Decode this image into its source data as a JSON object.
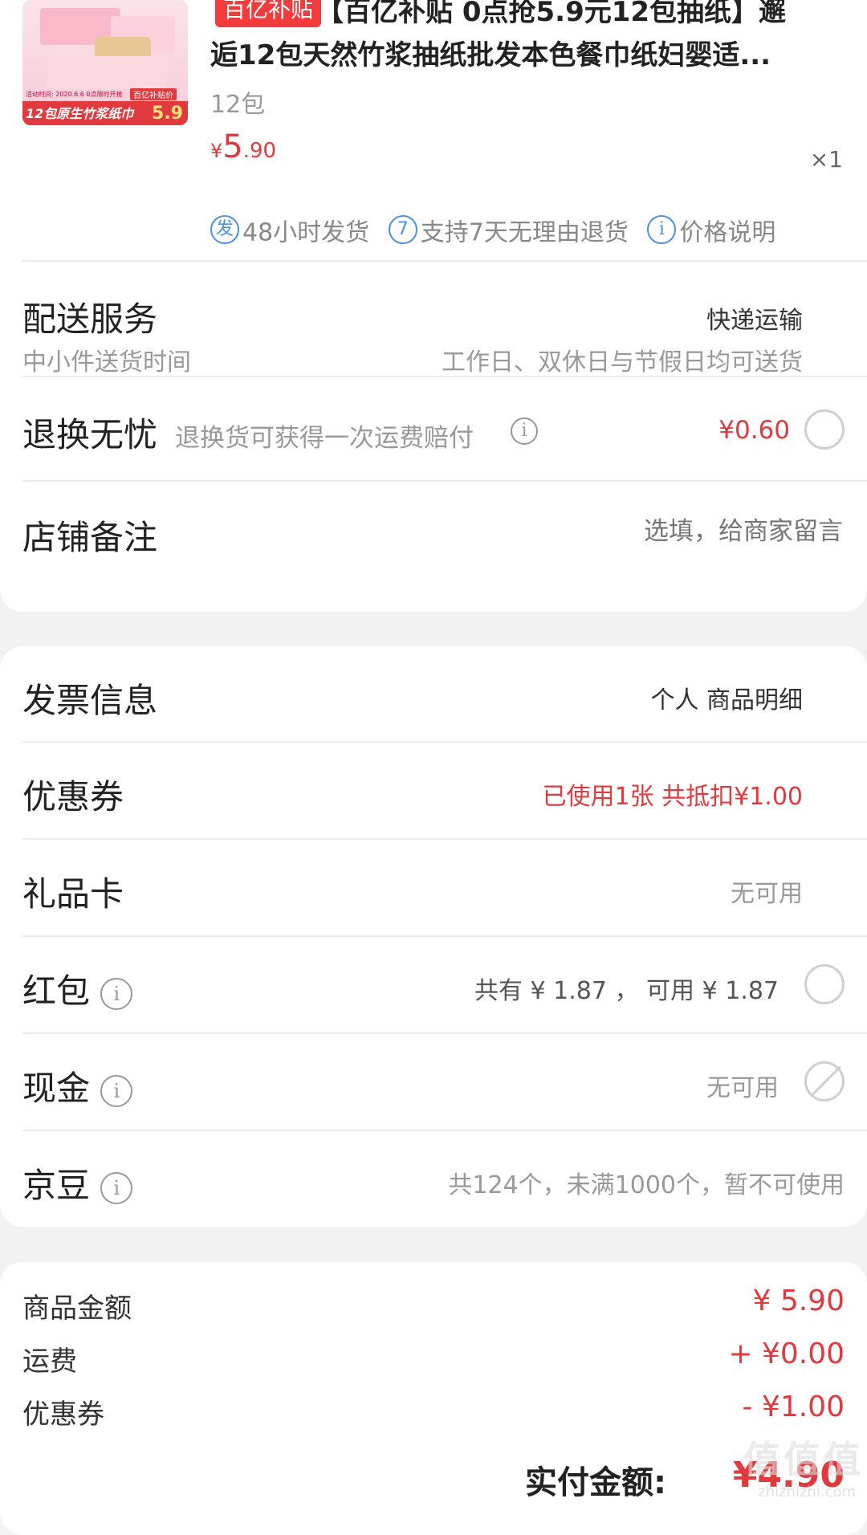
{
  "product": {
    "image_badge_text": "12包原生竹浆纸巾",
    "image_badge_price": "5.9",
    "image_small_text": "活动时间: 2020.6.6 0点限时开抢",
    "image_tag_text": "百亿补贴价",
    "badge": "百亿补贴",
    "title_line1": "【百亿补贴 0点抢5.9元12包抽纸】邂",
    "title_line2": "逅12包天然竹浆抽纸批发本色餐巾纸妇婴适...",
    "spec": "12包",
    "price_symbol": "¥",
    "price_int": "5",
    "price_dec": ".90",
    "quantity": "×1",
    "service_tags": [
      {
        "icon": "发",
        "label": "48小时发货"
      },
      {
        "icon": "7",
        "label": "支持7天无理由退货"
      },
      {
        "icon": "i",
        "label": "价格说明"
      }
    ]
  },
  "delivery": {
    "title": "配送服务",
    "value": "快递运输",
    "sub_label": "中小件送货时间",
    "sub_value": "工作日、双休日与节假日均可送货"
  },
  "return_insurance": {
    "title": "退换无忧",
    "desc": "退换货可获得一次运费赔付",
    "price": "¥0.60"
  },
  "shop_note": {
    "title": "店铺备注",
    "placeholder": "选填，给商家留言"
  },
  "invoice": {
    "title": "发票信息",
    "value": "个人 商品明细"
  },
  "coupon": {
    "title": "优惠券",
    "value": "已使用1张 共抵扣¥1.00"
  },
  "gift_card": {
    "title": "礼品卡",
    "value": "无可用"
  },
  "red_packet": {
    "title": "红包",
    "value": "共有 ¥ 1.87 ， 可用 ¥ 1.87"
  },
  "cash": {
    "title": "现金",
    "value": "无可用"
  },
  "jingdou": {
    "title": "京豆",
    "value": "共124个，未满1000个，暂不可使用"
  },
  "summary": {
    "items": [
      {
        "label": "商品金额",
        "value": "¥ 5.90"
      },
      {
        "label": "运费",
        "value": "+ ¥0.00"
      },
      {
        "label": "优惠券",
        "value": "- ¥1.00"
      }
    ],
    "total_label": "实付金额:",
    "total_value": "¥4.90"
  },
  "watermark": {
    "main": "值 值 值",
    "sub": "zhizhizhi.com"
  },
  "colors": {
    "accent_red": "#e0393e",
    "tag_blue": "#4a90e2",
    "page_bg": "#f2f2f2"
  }
}
